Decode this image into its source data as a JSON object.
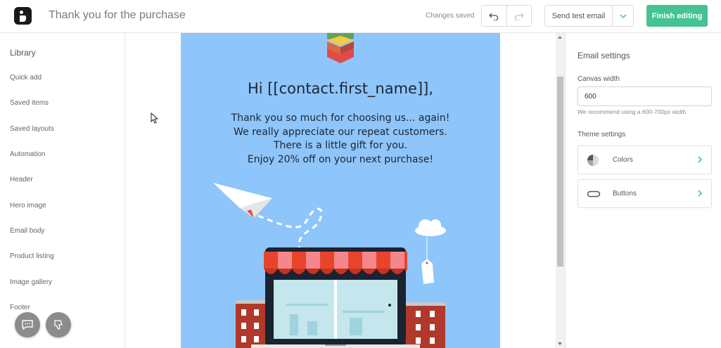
{
  "header": {
    "title": "Thank you for the purchase",
    "status": "Changes saved",
    "send_test_label": "Send test email",
    "finish_label": "Finish editing"
  },
  "library": {
    "title": "Library",
    "items": [
      "Quick add",
      "Saved items",
      "Saved layouts",
      "Automation",
      "Header",
      "Hero image",
      "Email body",
      "Product listing",
      "Image gallery",
      "Footer"
    ]
  },
  "email": {
    "greeting": "Hi [[contact.first_name]],",
    "lines": [
      "Thank you so much for choosing us... again!",
      "We really appreciate our repeat customers.",
      "There is a little gift for you.",
      "Enjoy 20% off on your next purchase!"
    ]
  },
  "settings": {
    "title": "Email settings",
    "canvas_width_label": "Canvas width",
    "canvas_width_value": "600",
    "canvas_hint": "We recommend using a 600-700px width",
    "theme_label": "Theme settings",
    "theme_items": [
      "Colors",
      "Buttons"
    ]
  },
  "icons": [
    "app-logo-icon",
    "undo-icon",
    "redo-icon",
    "chevron-down-icon",
    "chat-icon",
    "thumbs-down-icon",
    "palette-icon",
    "button-shape-icon",
    "chevron-right-icon"
  ],
  "colors": {
    "accent": "#46c393",
    "canvas_background": "#8ec5fa",
    "awning_red": "#e8442c",
    "text_dark": "#1c2533"
  }
}
